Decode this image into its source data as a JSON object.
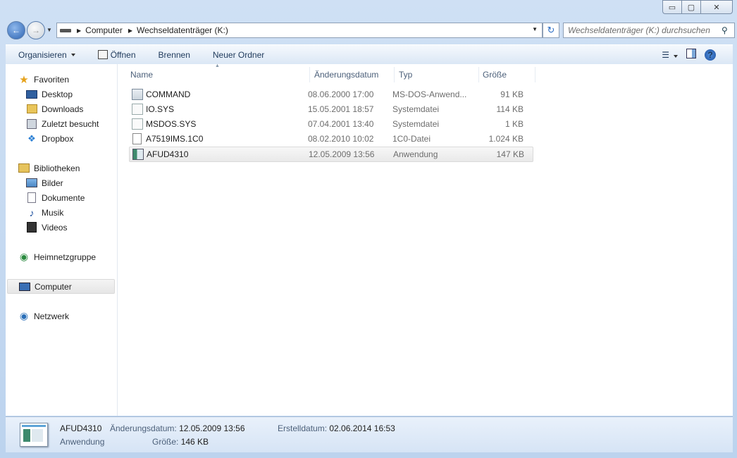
{
  "window": {
    "min": "▭",
    "max": "▢",
    "close": "✕"
  },
  "address": {
    "crumbs": [
      "Computer",
      "Wechseldatenträger (K:)"
    ],
    "search_placeholder": "Wechseldatenträger (K:) durchsuchen"
  },
  "toolbar": {
    "organize": "Organisieren",
    "open": "Öffnen",
    "burn": "Brennen",
    "new_folder": "Neuer Ordner",
    "help": "?"
  },
  "nav": {
    "favorites": "Favoriten",
    "desktop": "Desktop",
    "downloads": "Downloads",
    "recent": "Zuletzt besucht",
    "dropbox": "Dropbox",
    "libraries": "Bibliotheken",
    "pictures": "Bilder",
    "documents": "Dokumente",
    "music": "Musik",
    "videos": "Videos",
    "homegroup": "Heimnetzgruppe",
    "computer": "Computer",
    "network": "Netzwerk"
  },
  "columns": {
    "name": "Name",
    "date": "Änderungsdatum",
    "type": "Typ",
    "size": "Größe"
  },
  "files": [
    {
      "name": "COMMAND",
      "date": "08.06.2000 17:00",
      "type": "MS-DOS-Anwend...",
      "size": "91 KB",
      "icon": "app-icon"
    },
    {
      "name": "IO.SYS",
      "date": "15.05.2001 18:57",
      "type": "Systemdatei",
      "size": "114 KB",
      "icon": "system-file-icon"
    },
    {
      "name": "MSDOS.SYS",
      "date": "07.04.2001 13:40",
      "type": "Systemdatei",
      "size": "1 KB",
      "icon": "system-file-icon"
    },
    {
      "name": "A7519IMS.1C0",
      "date": "08.02.2010 10:02",
      "type": "1C0-Datei",
      "size": "1.024 KB",
      "icon": "file-icon"
    },
    {
      "name": "AFUD4310",
      "date": "12.05.2009 13:56",
      "type": "Anwendung",
      "size": "147 KB",
      "icon": "app-icon"
    }
  ],
  "details": {
    "name": "AFUD4310",
    "kind": "Anwendung",
    "modified_label": "Änderungsdatum:",
    "modified_value": "12.05.2009 13:56",
    "size_label": "Größe:",
    "size_value": "146 KB",
    "created_label": "Erstelldatum:",
    "created_value": "02.06.2014 16:53"
  }
}
